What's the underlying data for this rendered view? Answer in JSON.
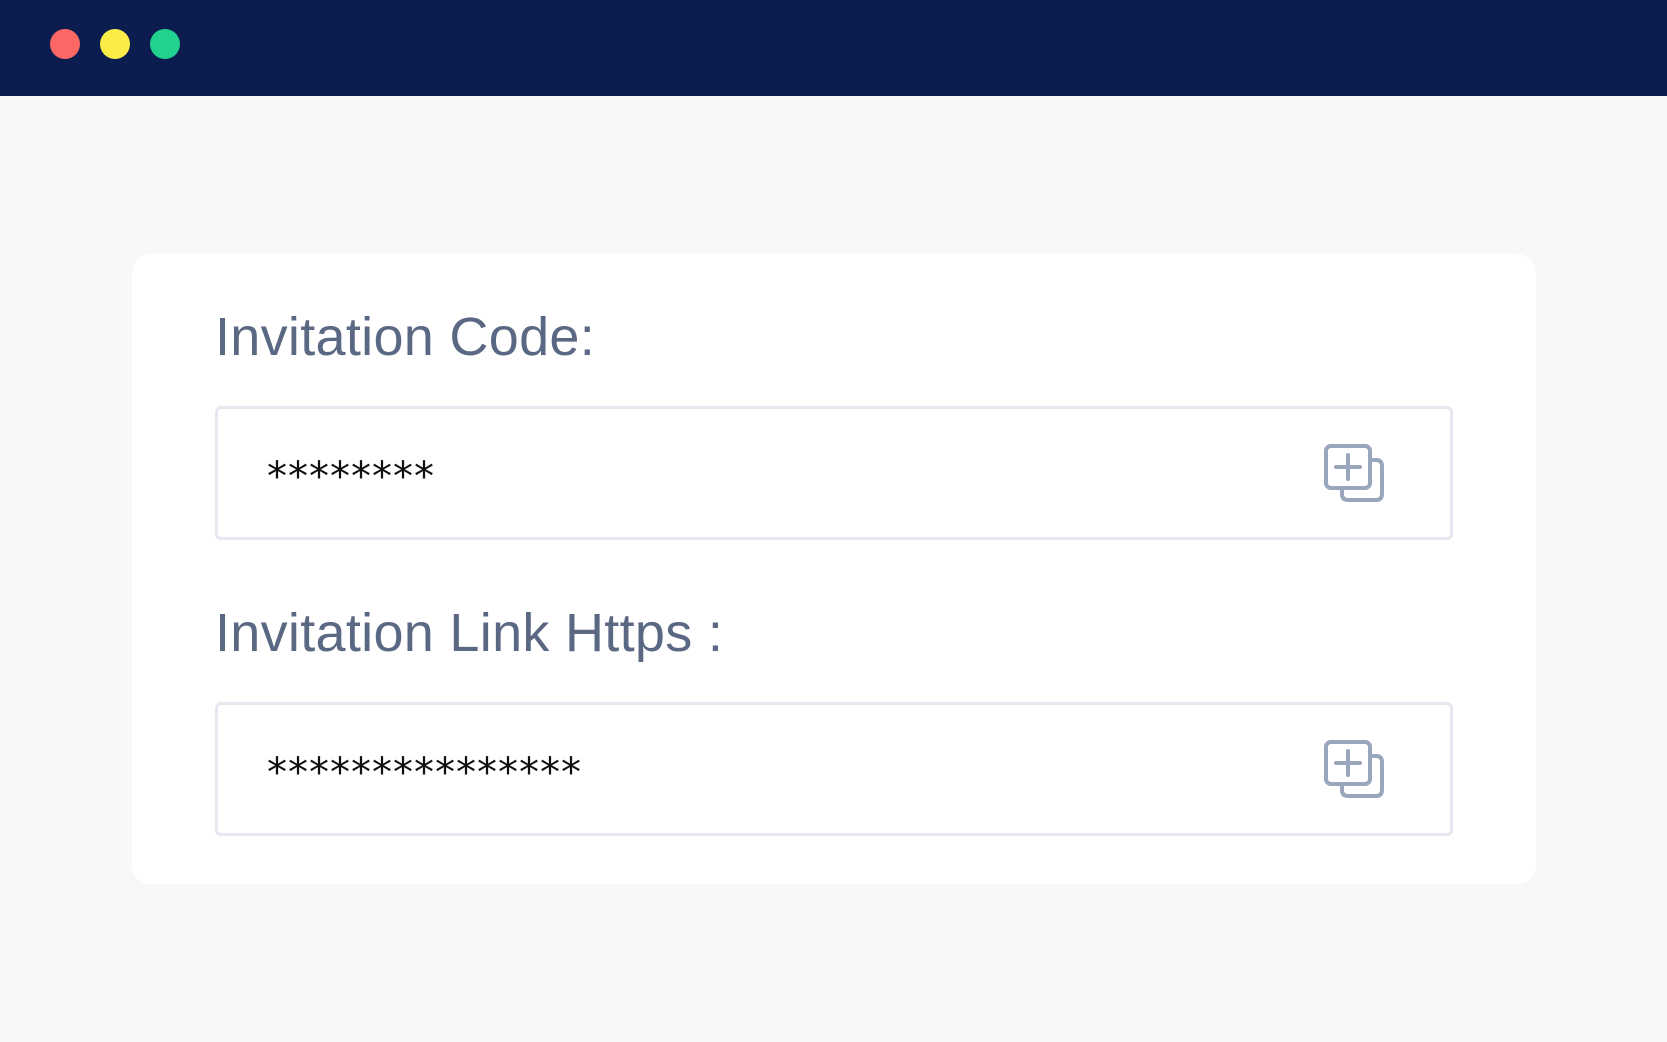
{
  "window": {
    "controls": [
      "close",
      "minimize",
      "maximize"
    ],
    "colors": {
      "titlebar": "#0b1d4f",
      "close": "#fc6766",
      "minimize": "#fbec48",
      "maximize": "#22d18d"
    }
  },
  "invitation_code": {
    "label": "Invitation Code:",
    "value": "********",
    "copy_icon": "copy-add-icon"
  },
  "invitation_link": {
    "label": "Invitation Link Https :",
    "value": "***************",
    "copy_icon": "copy-add-icon"
  }
}
